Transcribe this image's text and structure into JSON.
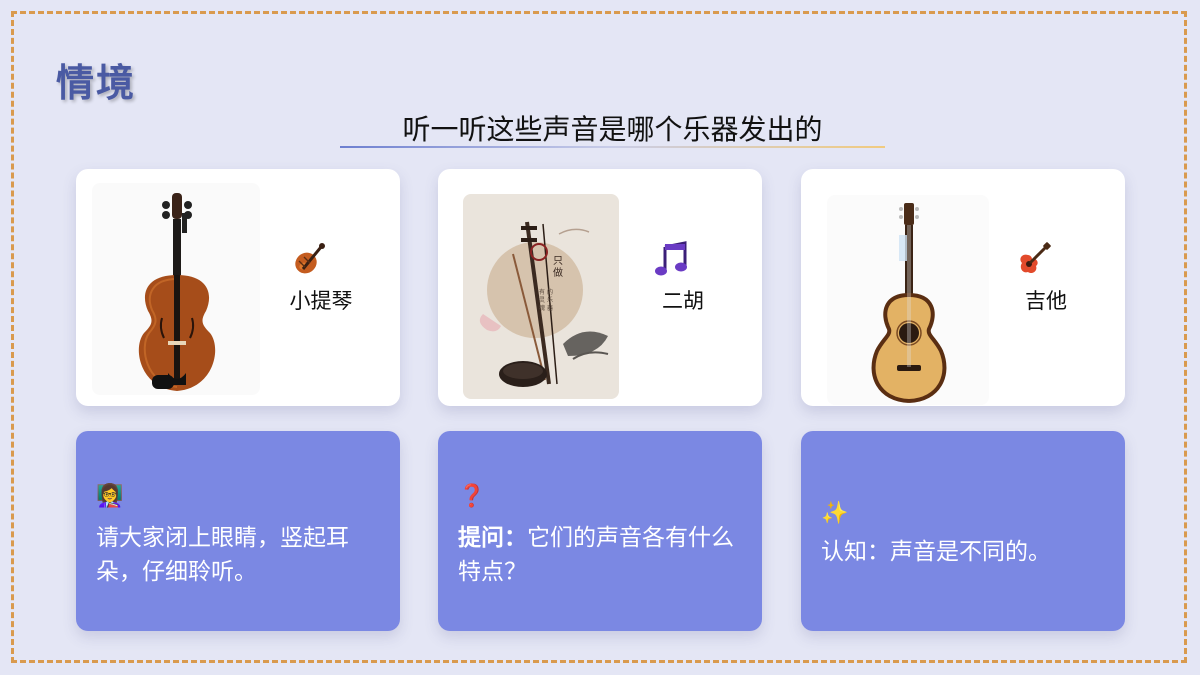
{
  "page": {
    "heading": "情境",
    "subtitle": "听一听这些声音是哪个乐器发出的"
  },
  "instruments": [
    {
      "label": "小提琴",
      "icon": "violin-icon"
    },
    {
      "label": "二胡",
      "icon": "music-notes-icon",
      "photo_text": [
        "只",
        "做",
        "有",
        "灵",
        "魂",
        "的",
        "乐",
        "器"
      ]
    },
    {
      "label": "吉他",
      "icon": "guitar-icon"
    }
  ],
  "prompts": [
    {
      "emoji": "👩‍🏫",
      "text": "请大家闭上眼睛，竖起耳朵，仔细聆听。"
    },
    {
      "emoji": "❓",
      "bold": "提问：",
      "text": "它们的声音各有什么特点？"
    },
    {
      "emoji": "✨",
      "text": "认知：声音是不同的。"
    }
  ],
  "colors": {
    "background": "#e4e6f5",
    "frame": "#d99a4e",
    "heading": "#4a5aa3",
    "card_accent": "#7b88e3"
  }
}
